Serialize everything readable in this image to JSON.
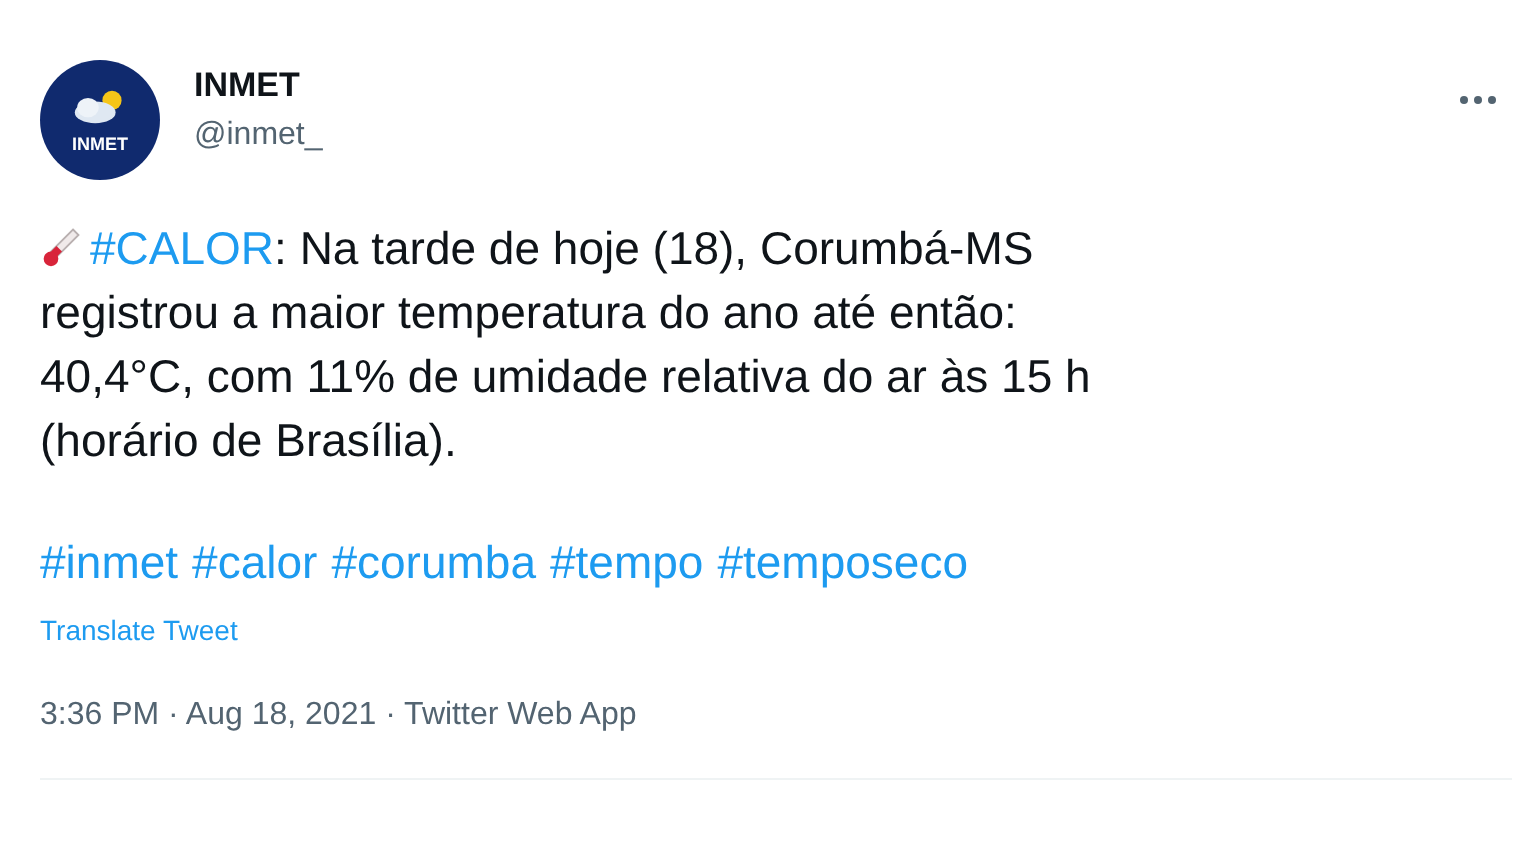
{
  "tweet": {
    "avatar_text": "INMET",
    "name": "INMET",
    "handle": "@inmet_",
    "body": {
      "hashtag": "#CALOR",
      "text": ": Na tarde de hoje (18), Corumbá-MS\nregistrou a maior temperatura do ano até então:\n40,4°C, com 11% de umidade relativa do ar às 15 h\n(horário de Brasília)."
    },
    "hashtags": [
      "#inmet",
      "#calor",
      "#corumba",
      "#tempo",
      "#temposeco"
    ],
    "translate": "Translate Tweet",
    "timestamp": "3:36 PM · Aug 18, 2021 · Twitter Web App"
  }
}
